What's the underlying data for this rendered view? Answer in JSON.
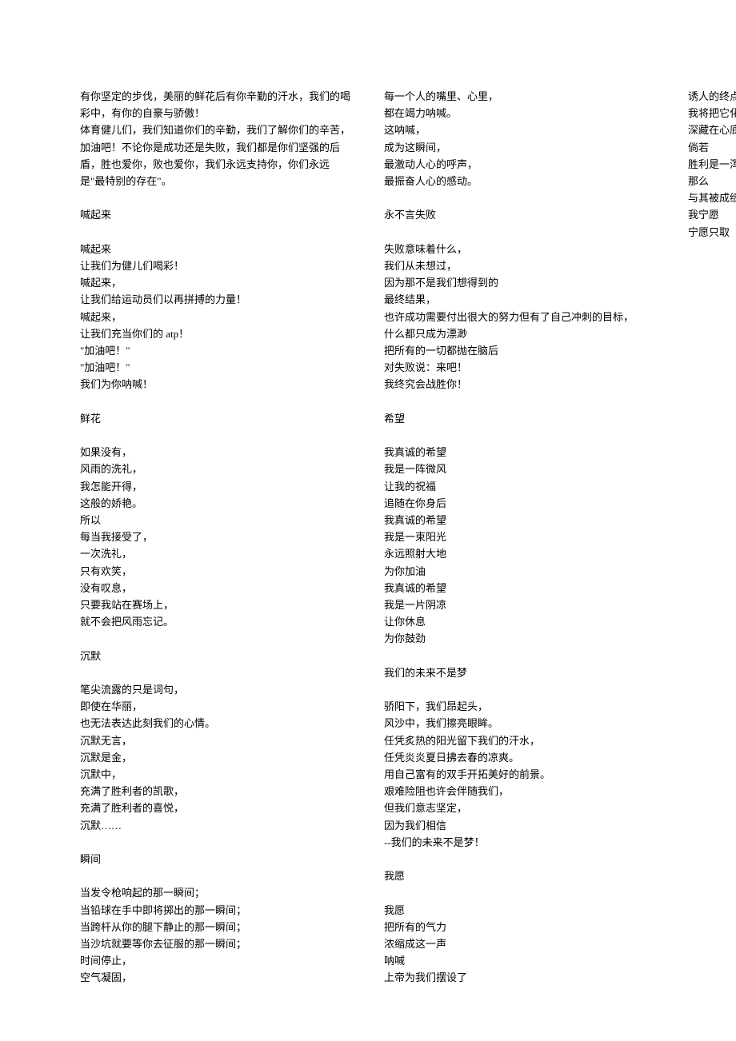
{
  "lines": [
    "有你坚定的步伐，美丽的鲜花后有你辛勤的汗水，我们的喝彩中，有你的自豪与骄傲！",
    "体育健儿们，我们知道你们的辛勤，我们了解你们的辛苦，加油吧！不论你是成功还是失败，我们都是你们坚强的后盾，胜也爱你，败也爱你，我们永远支持你，你们永远是\"最特别的存在\"。",
    "",
    "喊起来",
    "",
    "喊起来",
    "让我们为健儿们喝彩！",
    "喊起来，",
    "让我们给运动员们以再拼搏的力量！",
    "喊起来，",
    "让我们充当你们的 atp！",
    "\"加油吧！\"",
    "\"加油吧！\"",
    "我们为你呐喊！",
    "",
    "鲜花",
    "",
    "如果没有，",
    "风雨的洗礼，",
    "我怎能开得，",
    "这般的娇艳。",
    "所以",
    "每当我接受了，",
    "一次洗礼，",
    "只有欢笑，",
    "没有叹息，",
    "只要我站在赛场上，",
    "就不会把风雨忘记。",
    "",
    "沉默",
    "",
    "笔尖流露的只是词句，",
    "即使在华丽，",
    "也无法表达此刻我们的心情。",
    "沉默无言，",
    "沉默是金，",
    "沉默中，",
    "充满了胜利者的凯歌，",
    "充满了胜利者的喜悦，",
    "沉默……",
    "",
    "瞬间",
    "",
    "当发令枪响起的那一瞬间；",
    "当铅球在手中即将掷出的那一瞬间；",
    "当跨杆从你的腿下静止的那一瞬间；",
    "当沙坑就要等你去征服的那一瞬间；",
    "时间停止，",
    "空气凝固，",
    "每一个人的嘴里、心里，",
    "都在竭力呐喊。",
    "这呐喊，",
    "成为这瞬间，",
    "最激动人心的呼声，",
    "最振奋人心的感动。",
    "",
    "永不言失败",
    "",
    "失败意味着什么，",
    "我们从未想过，",
    "因为那不是我们想得到的",
    "最终结果，",
    "也许成功需要付出很大的努力但有了自己冲刺的目标，",
    "什么都只成为漂渺",
    "把所有的一切都抛在脑后",
    "对失败说：来吧！",
    "我终究会战胜你！",
    "",
    "希望",
    "",
    "我真诚的希望",
    "我是一阵微风",
    "让我的祝福",
    "追随在你身后",
    "我真诚的希望",
    "我是一束阳光",
    "永远照射大地",
    "为你加油",
    "我真诚的希望",
    "我是一片阴凉",
    "让你休息",
    "为你鼓劲",
    "",
    "我们的未来不是梦",
    "",
    "骄阳下，我们昂起头，",
    "风沙中，我们擦亮眼眸。",
    "任凭炙热的阳光留下我们的汗水，",
    "任凭炎炎夏日拂去春的凉爽。",
    "用自己富有的双手开拓美好的前景。",
    "艰难险阻也许会伴随我们，",
    "但我们意志坚定，",
    "因为我们相信",
    "--我们的未来不是梦！",
    "",
    "我愿",
    "",
    "我愿",
    "把所有的气力",
    "浓缩成这一声",
    "呐喊",
    "上帝为我们摆设了",
    "诱人的终点",
    "我将把它化作最后的声音",
    "深藏在心底",
    "倘若",
    "胜利是一浑然的在意",
    "那么",
    "与其被成绩压在下面",
    "我宁愿",
    "宁愿只取"
  ]
}
